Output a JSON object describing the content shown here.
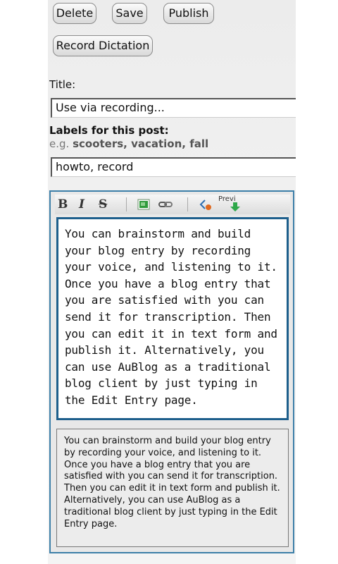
{
  "toolbar_buttons": {
    "delete": "Delete",
    "save": "Save",
    "publish": "Publish",
    "record_dictation": "Record Dictation"
  },
  "form": {
    "title_label": "Title:",
    "title_value": "Use via recording...",
    "labels_label": "Labels for this post:",
    "labels_hint_prefix": "e.g. ",
    "labels_hint_examples": "scooters, vacation, fall",
    "labels_value": "howto, record"
  },
  "editor_toolbar": {
    "bold": "B",
    "italic": "I",
    "strike": "S",
    "preview": "Previ"
  },
  "editor": {
    "body": "You can brainstorm and build your blog entry by recording your voice, and listening to it. Once you have a blog entry that you are satisfied with you can send it for transcription. Then you can edit it in text form and publish it. Alternatively, you can use AuBlog as a traditional blog client by just typing in the Edit Entry page.",
    "preview_body": "You can brainstorm and build your blog entry by recording your voice, and listening to it. Once you have a blog entry that you are satisfied with you can send it for transcription. Then you can edit it in text form and publish it. Alternatively, you can use AuBlog as a traditional blog client by just typing in the Edit Entry page."
  },
  "colors": {
    "editor_border": "#1e5f8c",
    "frame_border": "#3d7fa8",
    "icon_image": "#2e9a3a",
    "icon_preview_arrow": "#2fa84a"
  }
}
